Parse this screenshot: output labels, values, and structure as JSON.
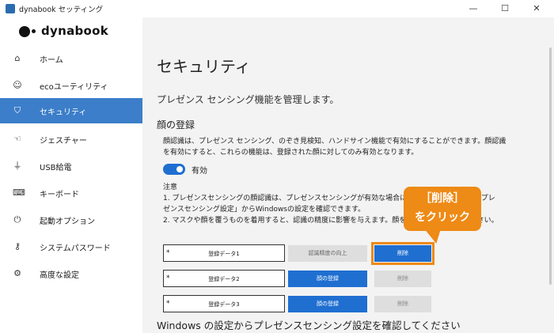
{
  "window": {
    "title": "dynabook セッティング",
    "min": "—",
    "max": "☐",
    "close": "✕"
  },
  "logo": {
    "text": "dynabook"
  },
  "sidebar": {
    "items": [
      {
        "label": "ホーム",
        "icon": "⌂"
      },
      {
        "label": "ecoユーティリティ",
        "icon": "☺"
      },
      {
        "label": "セキュリティ",
        "icon": "⛉"
      },
      {
        "label": "ジェスチャー",
        "icon": "☜"
      },
      {
        "label": "USB給電",
        "icon": "⏚"
      },
      {
        "label": "キーボード",
        "icon": "⌨"
      },
      {
        "label": "起動オプション",
        "icon": "⏻"
      },
      {
        "label": "システムパスワード",
        "icon": "⚷"
      },
      {
        "label": "高度な設定",
        "icon": "⚙"
      }
    ]
  },
  "main": {
    "title": "セキュリティ",
    "subtitle": "プレゼンス センシング機能を管理します。",
    "section_title": "顔の登録",
    "description": "顔認識は、プレゼンス センシング、のぞき見検知、ハンドサイン機能で有効にすることができます。顔認識を有効にすると、これらの機能は、登録された顔に対してのみ有効となります。",
    "toggle_label": "有効",
    "notes": "注意\n1. プレゼンスセンシングの顔認識は、プレゼンスセンシングが有効な場合にのみ有効になります。「プレゼンスセンシング設定」からWindowsの設定を確認できます。\n2. マスクや顔を覆うものを着用すると、認識の精度に影響を与えます。顔を覆うものは外してください。",
    "rows": [
      {
        "star": "*",
        "name": "登録データ1",
        "register": "認識精度の向上",
        "delete": "削除"
      },
      {
        "star": "*",
        "name": "登録データ2",
        "register": "顔の登録",
        "delete": "削除"
      },
      {
        "star": "*",
        "name": "登録データ3",
        "register": "顔の登録",
        "delete": "削除"
      }
    ],
    "footer": "Windows の設定からプレゼンスセンシング設定を確認してください"
  },
  "callout": {
    "line1": "［削除］",
    "line2": "をクリック"
  },
  "colors": {
    "accent": "#1f6fd1",
    "active_nav": "#3c7ec9",
    "callout": "#ee8a16"
  }
}
